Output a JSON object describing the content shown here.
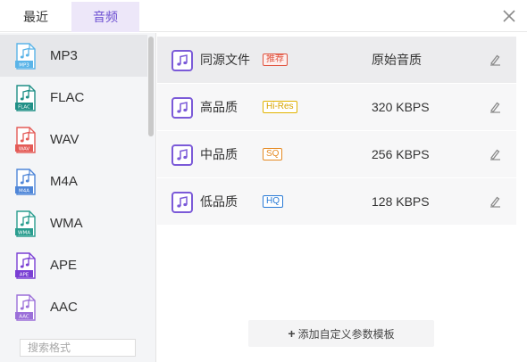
{
  "tabs": [
    {
      "label": "最近",
      "active": false
    },
    {
      "label": "音频",
      "active": true
    }
  ],
  "formats": [
    {
      "name": "MP3",
      "tag": "MP3",
      "color": "#5ab4e8",
      "active": true
    },
    {
      "name": "FLAC",
      "tag": "FLAC",
      "color": "#1f8f86",
      "active": false
    },
    {
      "name": "WAV",
      "tag": "WAV",
      "color": "#e45b57",
      "active": false
    },
    {
      "name": "M4A",
      "tag": "M4A",
      "color": "#4f86d8",
      "active": false
    },
    {
      "name": "WMA",
      "tag": "WMA",
      "color": "#2a9d8f",
      "active": false
    },
    {
      "name": "APE",
      "tag": "APE",
      "color": "#7a3fd4",
      "active": false
    },
    {
      "name": "AAC",
      "tag": "AAC",
      "color": "#9b6fd9",
      "active": false
    }
  ],
  "search": {
    "placeholder": "搜索格式"
  },
  "qualities": [
    {
      "name": "同源文件",
      "badge": "推荐",
      "badge_style": "red",
      "rate": "原始音质",
      "active": true
    },
    {
      "name": "高品质",
      "badge": "Hi-Res",
      "badge_style": "yellow",
      "rate": "320 KBPS",
      "active": false
    },
    {
      "name": "中品质",
      "badge": "SQ",
      "badge_style": "orange",
      "rate": "256 KBPS",
      "active": false
    },
    {
      "name": "低品质",
      "badge": "HQ",
      "badge_style": "blue",
      "rate": "128 KBPS",
      "active": false
    }
  ],
  "add_template": {
    "label": "添加自定义参数模板"
  },
  "colors": {
    "accent": "#7b5ad8",
    "tab_active_bg": "#ede7f9"
  }
}
